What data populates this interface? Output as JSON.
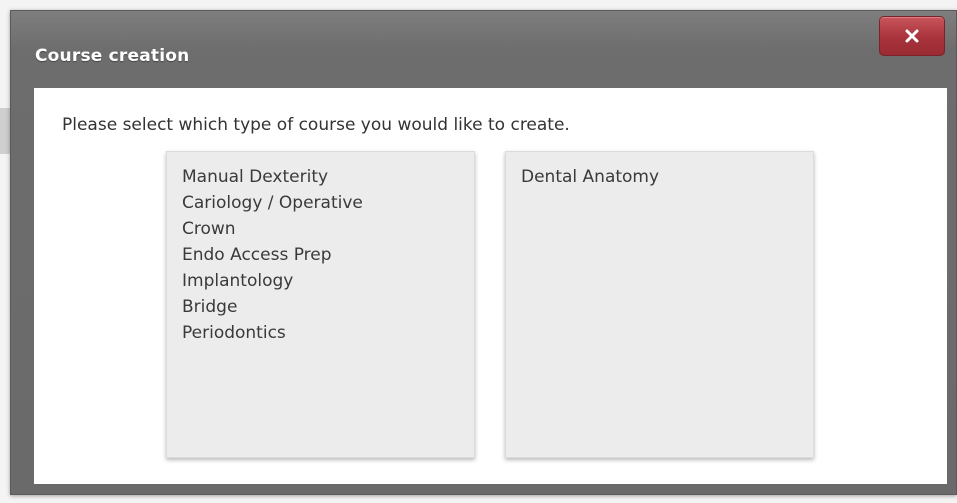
{
  "dialog": {
    "title": "Course creation",
    "close_icon": "close-icon",
    "prompt": "Please select which type of course you would like to create."
  },
  "course_types": {
    "left_column": [
      "Manual Dexterity",
      "Cariology / Operative",
      "Crown",
      "Endo Access Prep",
      "Implantology",
      "Bridge",
      "Periodontics"
    ],
    "right_column": [
      "Dental Anatomy"
    ]
  },
  "colors": {
    "header_gray": "#6d6d6d",
    "close_red": "#a8333b",
    "box_gray": "#ececec",
    "text": "#333333"
  }
}
